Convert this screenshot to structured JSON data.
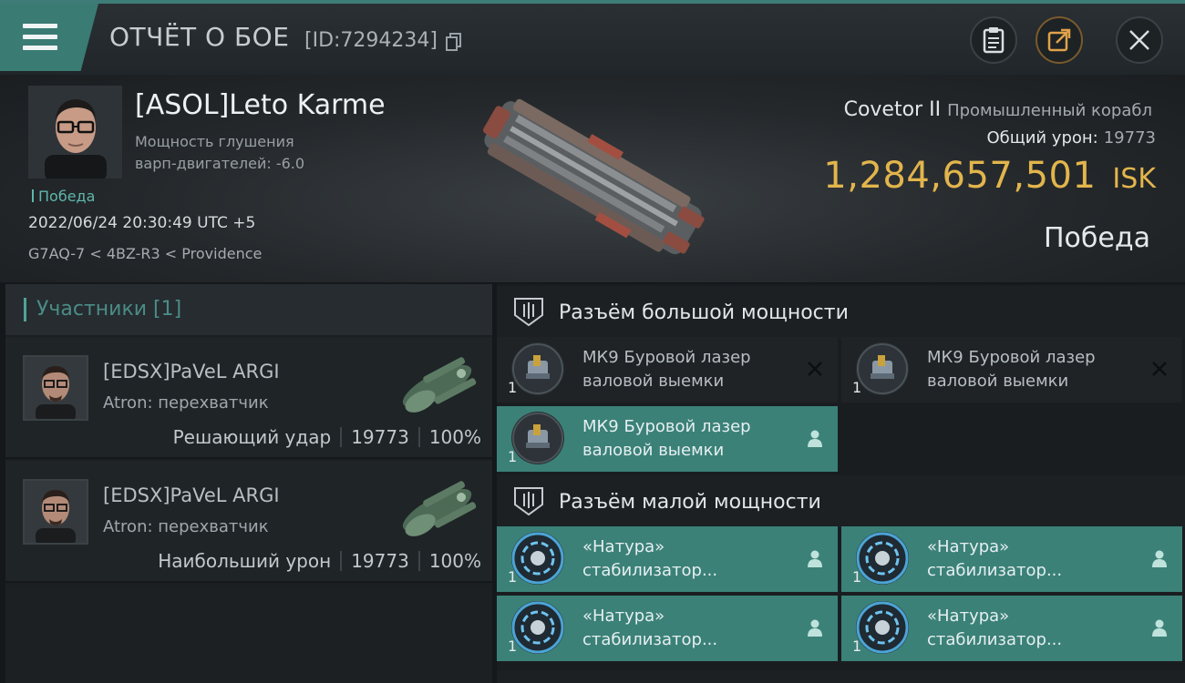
{
  "header": {
    "title": "ОТЧЁТ О БОЕ",
    "report_id": "[ID:7294234]"
  },
  "victim": {
    "name": "[ASOL]Leto Karme",
    "stat_line1": "Мощность глушения",
    "stat_line2": "варп-двигателей: -6.0",
    "result_tag": "Победа",
    "datetime": "2022/06/24 20:30:49 UTC +5",
    "location": "G7AQ-7 < 4BZ-R3 < Providence",
    "ship_name": "Covetor II",
    "ship_class": "Промышленный корабл",
    "damage_label": "Общий урон:",
    "damage_value": "19773",
    "isk_value": "1,284,657,501",
    "isk_unit": "ISK",
    "result": "Победа"
  },
  "participants": {
    "header": "Участники [1]",
    "rows": [
      {
        "name": "[EDSX]PaVeL ARGI",
        "ship": "Atron: перехватчик",
        "role": "Решающий удар",
        "damage": "19773",
        "percent": "100%"
      },
      {
        "name": "[EDSX]PaVeL ARGI",
        "ship": "Atron: перехватчик",
        "role": "Наибольший урон",
        "damage": "19773",
        "percent": "100%"
      }
    ]
  },
  "fittings": {
    "high": {
      "title": "Разъём большой мощности",
      "modules": [
        {
          "line1": "МК9 Буровой лазер",
          "line2": "валовой выемки",
          "qty": "1",
          "state": "destroyed"
        },
        {
          "line1": "МК9 Буровой лазер",
          "line2": "валовой выемки",
          "qty": "1",
          "state": "destroyed"
        },
        {
          "line1": "МК9 Буровой лазер",
          "line2": "валовой выемки",
          "qty": "1",
          "state": "dropped"
        }
      ]
    },
    "low": {
      "title": "Разъём малой мощности",
      "modules": [
        {
          "line1": "«Натура»",
          "line2": "стабилизатор...",
          "qty": "1",
          "state": "dropped"
        },
        {
          "line1": "«Натура»",
          "line2": "стабилизатор...",
          "qty": "1",
          "state": "dropped"
        },
        {
          "line1": "«Натура»",
          "line2": "стабилизатор...",
          "qty": "1",
          "state": "dropped"
        },
        {
          "line1": "«Натура»",
          "line2": "стабилизатор...",
          "qty": "1",
          "state": "dropped"
        }
      ]
    }
  },
  "icons": {
    "menu": "menu-icon",
    "copy": "copy-icon",
    "clipboard": "clipboard-icon",
    "share": "share-icon",
    "close": "close-icon",
    "slot": "slot-icon",
    "destroyed": "close-x-icon",
    "dropped": "person-icon"
  },
  "colors": {
    "accent": "#3b8178",
    "isk": "#e2b54c",
    "result": "#5fb7ad"
  }
}
